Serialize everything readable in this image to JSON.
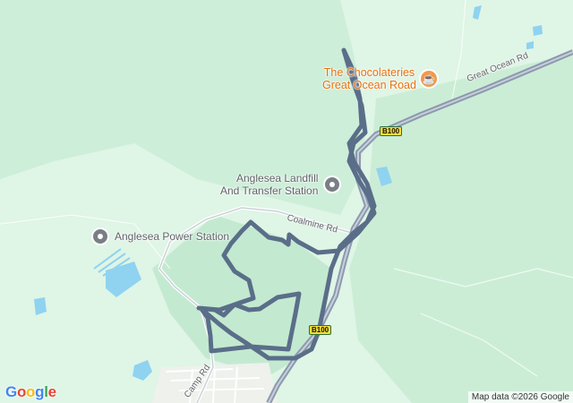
{
  "map": {
    "places": [
      {
        "name_line1": "Anglesea Landfill",
        "name_line2": "And Transfer Station"
      },
      {
        "name_line1": "Anglesea Power Station"
      }
    ],
    "cafe": {
      "line1": "The Chocolateries",
      "line2": "Great Ocean Road",
      "icon": "coffee-cup-icon"
    },
    "roads": {
      "great_ocean_rd": "Great Ocean Rd",
      "coalmine_rd": "Coalmine Rd",
      "camp_rd": "Camp Rd"
    },
    "shields": [
      "B100",
      "B100"
    ],
    "attribution": "Map data ©2026 Google",
    "logo": [
      "G",
      "o",
      "o",
      "g",
      "l",
      "e"
    ],
    "colors": {
      "background": "#dff5e6",
      "forest": "#c9ecd5",
      "route": "#5a6e89",
      "highway": "#8d99ae",
      "water": "#8fd3f0",
      "poi_text": "#5f6368",
      "cafe": "#e8710a"
    }
  }
}
